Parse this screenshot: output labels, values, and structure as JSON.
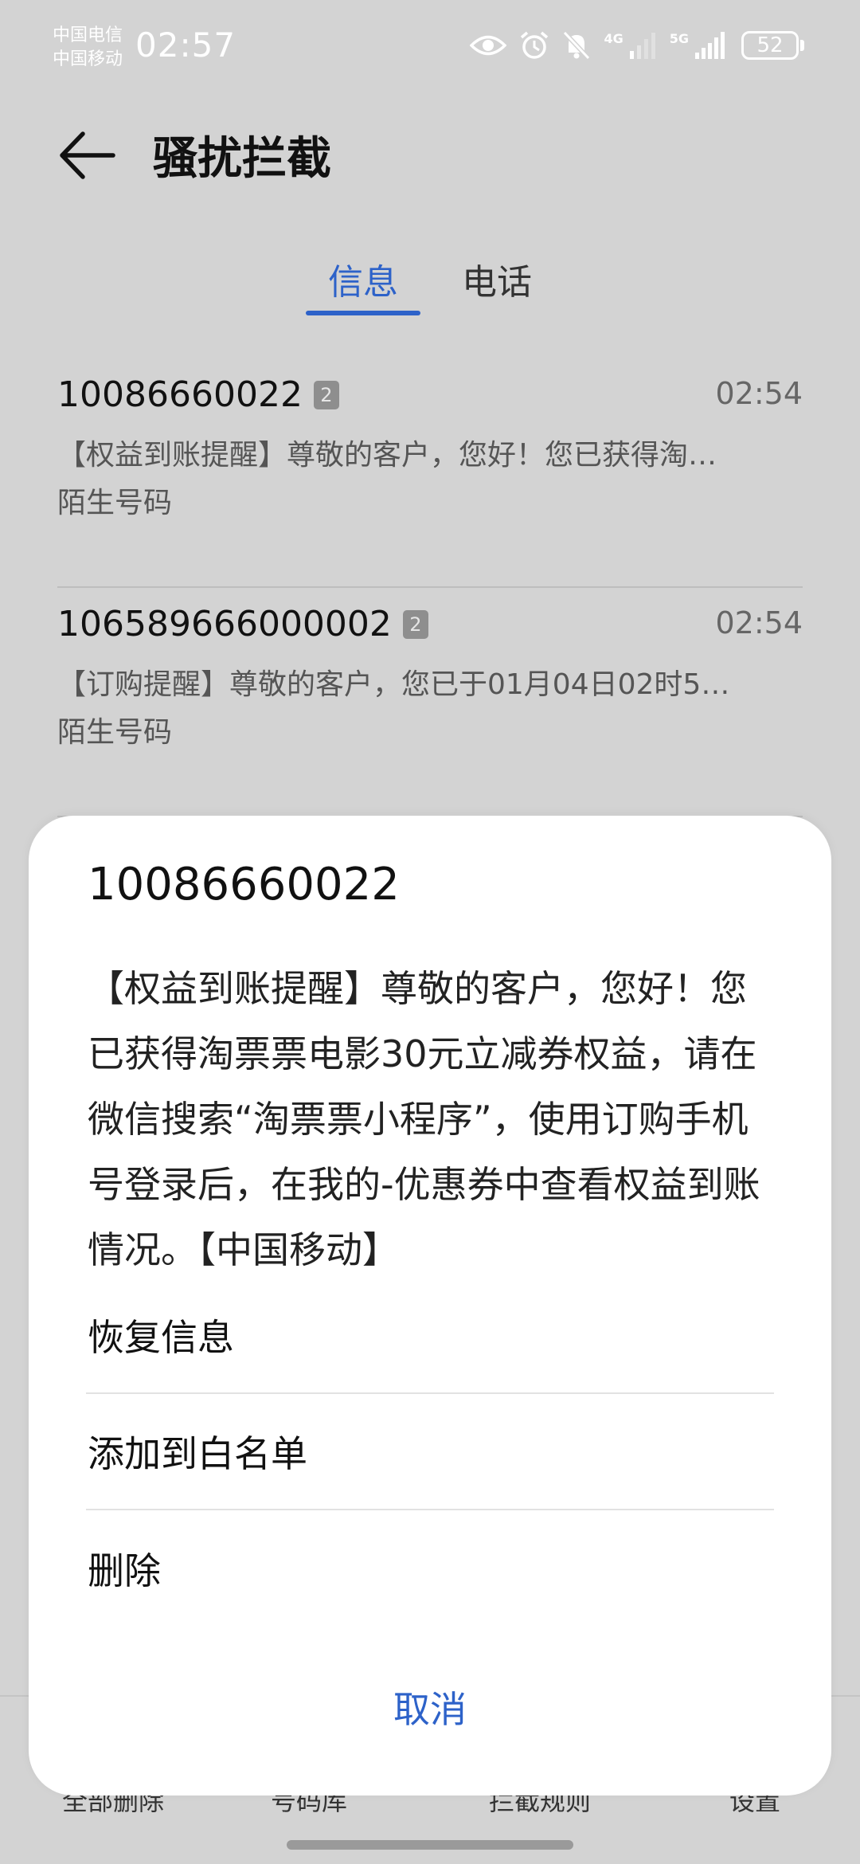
{
  "status_bar": {
    "carrier_1": "中国电信",
    "carrier_2": "中国移动",
    "time": "02:57",
    "net_4g": "4G",
    "net_5g": "5G",
    "battery": "52"
  },
  "header": {
    "title": "骚扰拦截"
  },
  "tabs": [
    {
      "label": "信息",
      "active": true
    },
    {
      "label": "电话",
      "active": false
    }
  ],
  "messages": [
    {
      "sender": "10086660022",
      "count": "2",
      "time": "02:54",
      "preview": "【权益到账提醒】尊敬的客户，您好！您已获得淘…",
      "tag": "陌生号码"
    },
    {
      "sender": "106589666000002",
      "count": "2",
      "time": "02:54",
      "preview": "【订购提醒】尊敬的客户，您已于01月04日02时5…",
      "tag": "陌生号码"
    }
  ],
  "bottom_nav": [
    "全部删除",
    "号码库",
    "拦截规则",
    "设置"
  ],
  "sheet": {
    "title": "10086660022",
    "body": "【权益到账提醒】尊敬的客户，您好！您已获得淘票票电影30元立减券权益，请在微信搜索“淘票票小程序”，使用订购手机号登录后，在我的-优惠券中查看权益到账情况。【中国移动】",
    "actions": [
      {
        "label": "恢复信息"
      },
      {
        "label": "添加到白名单"
      },
      {
        "label": "删除"
      }
    ],
    "cancel": "取消"
  },
  "colors": {
    "accent": "#2d62c9",
    "overlay_bg": "#d3d3d3",
    "sheet_bg": "#ffffff"
  }
}
